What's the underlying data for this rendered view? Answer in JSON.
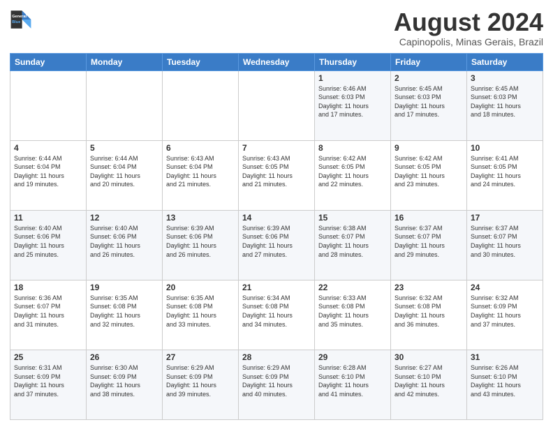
{
  "logo": {
    "line1": "General",
    "line2": "Blue"
  },
  "title": "August 2024",
  "subtitle": "Capinopolis, Minas Gerais, Brazil",
  "weekdays": [
    "Sunday",
    "Monday",
    "Tuesday",
    "Wednesday",
    "Thursday",
    "Friday",
    "Saturday"
  ],
  "weeks": [
    [
      {
        "day": "",
        "info": ""
      },
      {
        "day": "",
        "info": ""
      },
      {
        "day": "",
        "info": ""
      },
      {
        "day": "",
        "info": ""
      },
      {
        "day": "1",
        "info": "Sunrise: 6:46 AM\nSunset: 6:03 PM\nDaylight: 11 hours\nand 17 minutes."
      },
      {
        "day": "2",
        "info": "Sunrise: 6:45 AM\nSunset: 6:03 PM\nDaylight: 11 hours\nand 17 minutes."
      },
      {
        "day": "3",
        "info": "Sunrise: 6:45 AM\nSunset: 6:03 PM\nDaylight: 11 hours\nand 18 minutes."
      }
    ],
    [
      {
        "day": "4",
        "info": "Sunrise: 6:44 AM\nSunset: 6:04 PM\nDaylight: 11 hours\nand 19 minutes."
      },
      {
        "day": "5",
        "info": "Sunrise: 6:44 AM\nSunset: 6:04 PM\nDaylight: 11 hours\nand 20 minutes."
      },
      {
        "day": "6",
        "info": "Sunrise: 6:43 AM\nSunset: 6:04 PM\nDaylight: 11 hours\nand 21 minutes."
      },
      {
        "day": "7",
        "info": "Sunrise: 6:43 AM\nSunset: 6:05 PM\nDaylight: 11 hours\nand 21 minutes."
      },
      {
        "day": "8",
        "info": "Sunrise: 6:42 AM\nSunset: 6:05 PM\nDaylight: 11 hours\nand 22 minutes."
      },
      {
        "day": "9",
        "info": "Sunrise: 6:42 AM\nSunset: 6:05 PM\nDaylight: 11 hours\nand 23 minutes."
      },
      {
        "day": "10",
        "info": "Sunrise: 6:41 AM\nSunset: 6:05 PM\nDaylight: 11 hours\nand 24 minutes."
      }
    ],
    [
      {
        "day": "11",
        "info": "Sunrise: 6:40 AM\nSunset: 6:06 PM\nDaylight: 11 hours\nand 25 minutes."
      },
      {
        "day": "12",
        "info": "Sunrise: 6:40 AM\nSunset: 6:06 PM\nDaylight: 11 hours\nand 26 minutes."
      },
      {
        "day": "13",
        "info": "Sunrise: 6:39 AM\nSunset: 6:06 PM\nDaylight: 11 hours\nand 26 minutes."
      },
      {
        "day": "14",
        "info": "Sunrise: 6:39 AM\nSunset: 6:06 PM\nDaylight: 11 hours\nand 27 minutes."
      },
      {
        "day": "15",
        "info": "Sunrise: 6:38 AM\nSunset: 6:07 PM\nDaylight: 11 hours\nand 28 minutes."
      },
      {
        "day": "16",
        "info": "Sunrise: 6:37 AM\nSunset: 6:07 PM\nDaylight: 11 hours\nand 29 minutes."
      },
      {
        "day": "17",
        "info": "Sunrise: 6:37 AM\nSunset: 6:07 PM\nDaylight: 11 hours\nand 30 minutes."
      }
    ],
    [
      {
        "day": "18",
        "info": "Sunrise: 6:36 AM\nSunset: 6:07 PM\nDaylight: 11 hours\nand 31 minutes."
      },
      {
        "day": "19",
        "info": "Sunrise: 6:35 AM\nSunset: 6:08 PM\nDaylight: 11 hours\nand 32 minutes."
      },
      {
        "day": "20",
        "info": "Sunrise: 6:35 AM\nSunset: 6:08 PM\nDaylight: 11 hours\nand 33 minutes."
      },
      {
        "day": "21",
        "info": "Sunrise: 6:34 AM\nSunset: 6:08 PM\nDaylight: 11 hours\nand 34 minutes."
      },
      {
        "day": "22",
        "info": "Sunrise: 6:33 AM\nSunset: 6:08 PM\nDaylight: 11 hours\nand 35 minutes."
      },
      {
        "day": "23",
        "info": "Sunrise: 6:32 AM\nSunset: 6:08 PM\nDaylight: 11 hours\nand 36 minutes."
      },
      {
        "day": "24",
        "info": "Sunrise: 6:32 AM\nSunset: 6:09 PM\nDaylight: 11 hours\nand 37 minutes."
      }
    ],
    [
      {
        "day": "25",
        "info": "Sunrise: 6:31 AM\nSunset: 6:09 PM\nDaylight: 11 hours\nand 37 minutes."
      },
      {
        "day": "26",
        "info": "Sunrise: 6:30 AM\nSunset: 6:09 PM\nDaylight: 11 hours\nand 38 minutes."
      },
      {
        "day": "27",
        "info": "Sunrise: 6:29 AM\nSunset: 6:09 PM\nDaylight: 11 hours\nand 39 minutes."
      },
      {
        "day": "28",
        "info": "Sunrise: 6:29 AM\nSunset: 6:09 PM\nDaylight: 11 hours\nand 40 minutes."
      },
      {
        "day": "29",
        "info": "Sunrise: 6:28 AM\nSunset: 6:10 PM\nDaylight: 11 hours\nand 41 minutes."
      },
      {
        "day": "30",
        "info": "Sunrise: 6:27 AM\nSunset: 6:10 PM\nDaylight: 11 hours\nand 42 minutes."
      },
      {
        "day": "31",
        "info": "Sunrise: 6:26 AM\nSunset: 6:10 PM\nDaylight: 11 hours\nand 43 minutes."
      }
    ]
  ]
}
